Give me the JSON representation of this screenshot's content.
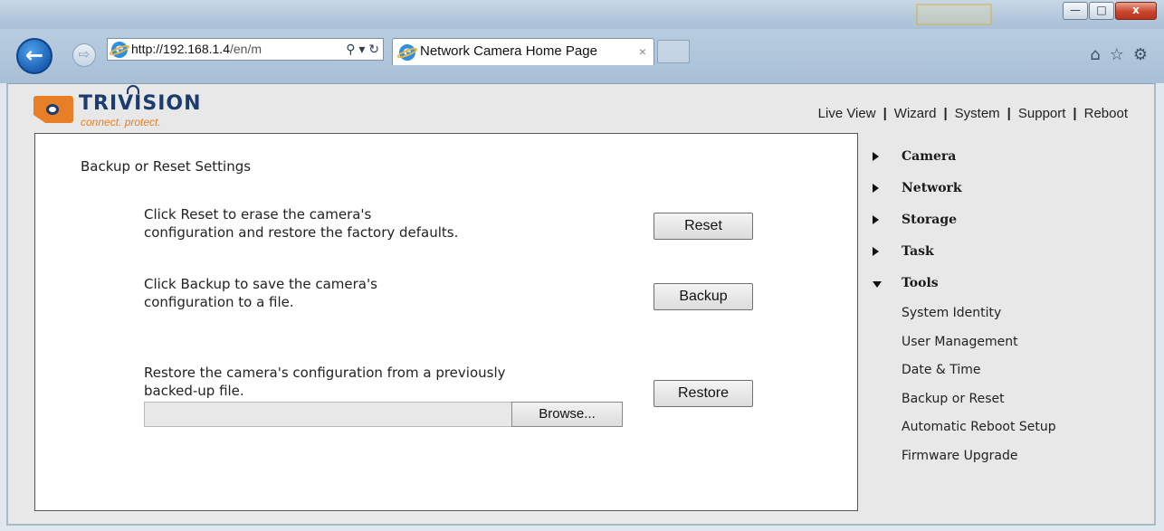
{
  "browser": {
    "address_host": "http://192.168.1.4",
    "address_rest": "/en/m",
    "tab_title": "Network Camera Home Page",
    "tab_close": "×",
    "window_buttons": {
      "minimize": "—",
      "maximize": "□",
      "close": "x"
    }
  },
  "header": {
    "logo_name": "TRIVISION",
    "logo_tagline": "connect. protect.",
    "top_nav": [
      "Live View",
      "Wizard",
      "System",
      "Support",
      "Reboot"
    ],
    "separator": "|"
  },
  "main": {
    "title": "Backup or Reset Settings",
    "reset_text": [
      "Click Reset to erase the camera's",
      "configuration and restore the factory defaults."
    ],
    "reset_button": "Reset",
    "backup_text": [
      "Click Backup to save the camera's",
      "configuration to a file."
    ],
    "backup_button": "Backup",
    "restore_text": [
      "Restore the camera's configuration from a previously",
      "backed-up file."
    ],
    "restore_button": "Restore",
    "browse_button": "Browse...",
    "file_value": ""
  },
  "sidebar": {
    "items": [
      {
        "label": "Camera",
        "expanded": false
      },
      {
        "label": "Network",
        "expanded": false
      },
      {
        "label": "Storage",
        "expanded": false
      },
      {
        "label": "Task",
        "expanded": false
      },
      {
        "label": "Tools",
        "expanded": true
      }
    ],
    "tools_sub": [
      "System Identity",
      "User Management",
      "Date & Time",
      "Backup or Reset",
      "Automatic Reboot Setup",
      "Firmware Upgrade"
    ]
  },
  "colors": {
    "brand_orange": "#e87e26",
    "brand_navy": "#1c3b6e",
    "ie_blue": "#2f8fe0"
  }
}
